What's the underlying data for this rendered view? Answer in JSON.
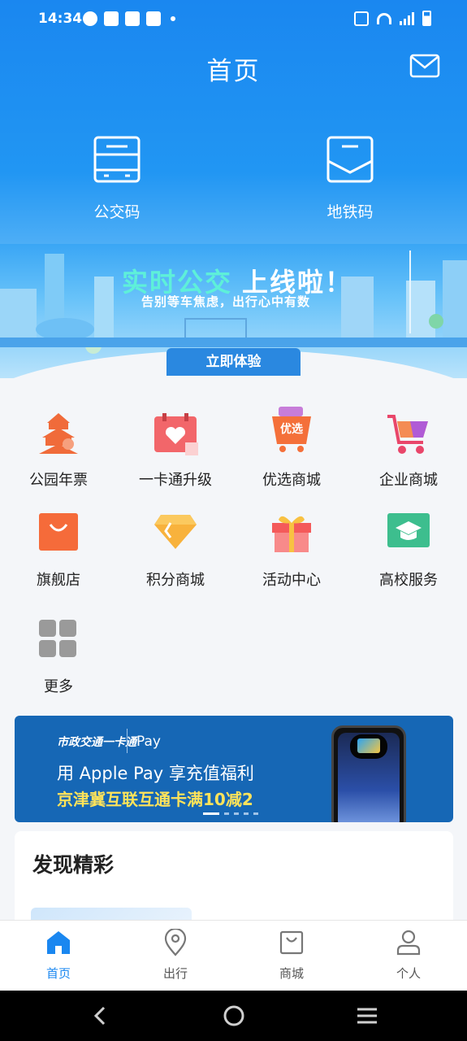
{
  "status_bar": {
    "time": "14:34"
  },
  "header": {
    "title": "首页"
  },
  "quick_codes": [
    {
      "label": "公交码",
      "icon": "bus-code-icon"
    },
    {
      "label": "地铁码",
      "icon": "metro-code-icon"
    }
  ],
  "promo": {
    "headline_part1": "实时公交",
    "headline_part2": "上线啦！",
    "subtitle": "告别等车焦虑，出行心中有数",
    "button": "立即体验"
  },
  "services": [
    {
      "label": "公园年票",
      "icon": "pagoda-icon",
      "color": "#f06b3a"
    },
    {
      "label": "一卡通升级",
      "icon": "calendar-heart-icon",
      "color": "#f2666a"
    },
    {
      "label": "优选商城",
      "icon": "shopping-bag-icon",
      "color": "#f4703a"
    },
    {
      "label": "企业商城",
      "icon": "shopping-cart-icon",
      "color": "#e9466a"
    },
    {
      "label": "旗舰店",
      "icon": "store-bag-icon",
      "color": "#f56b3a"
    },
    {
      "label": "积分商城",
      "icon": "diamond-icon",
      "color": "#f8b23c"
    },
    {
      "label": "活动中心",
      "icon": "gift-icon",
      "color": "#f45a5a"
    },
    {
      "label": "高校服务",
      "icon": "graduation-cap-icon",
      "color": "#3dbe8e"
    },
    {
      "label": "更多",
      "icon": "grid-more-icon",
      "color": "#9a9a9a"
    }
  ],
  "pay_banner": {
    "brand_left": "市政交通一卡通",
    "brand_right": "Pay",
    "line1": "用 Apple Pay 享充值福利",
    "line2": "京津冀互联互通卡满10减2",
    "page_total": 5,
    "page_current": 1
  },
  "discover": {
    "title": "发现精彩"
  },
  "tabs": [
    {
      "label": "首页",
      "icon": "home-icon",
      "active": true
    },
    {
      "label": "出行",
      "icon": "location-pin-icon",
      "active": false
    },
    {
      "label": "商城",
      "icon": "shopping-bag-icon",
      "active": false
    },
    {
      "label": "个人",
      "icon": "person-icon",
      "active": false
    }
  ],
  "colors": {
    "primary": "#1a87f0",
    "pay_banner_bg": "#1667b5",
    "pay_highlight": "#ffe35a"
  }
}
